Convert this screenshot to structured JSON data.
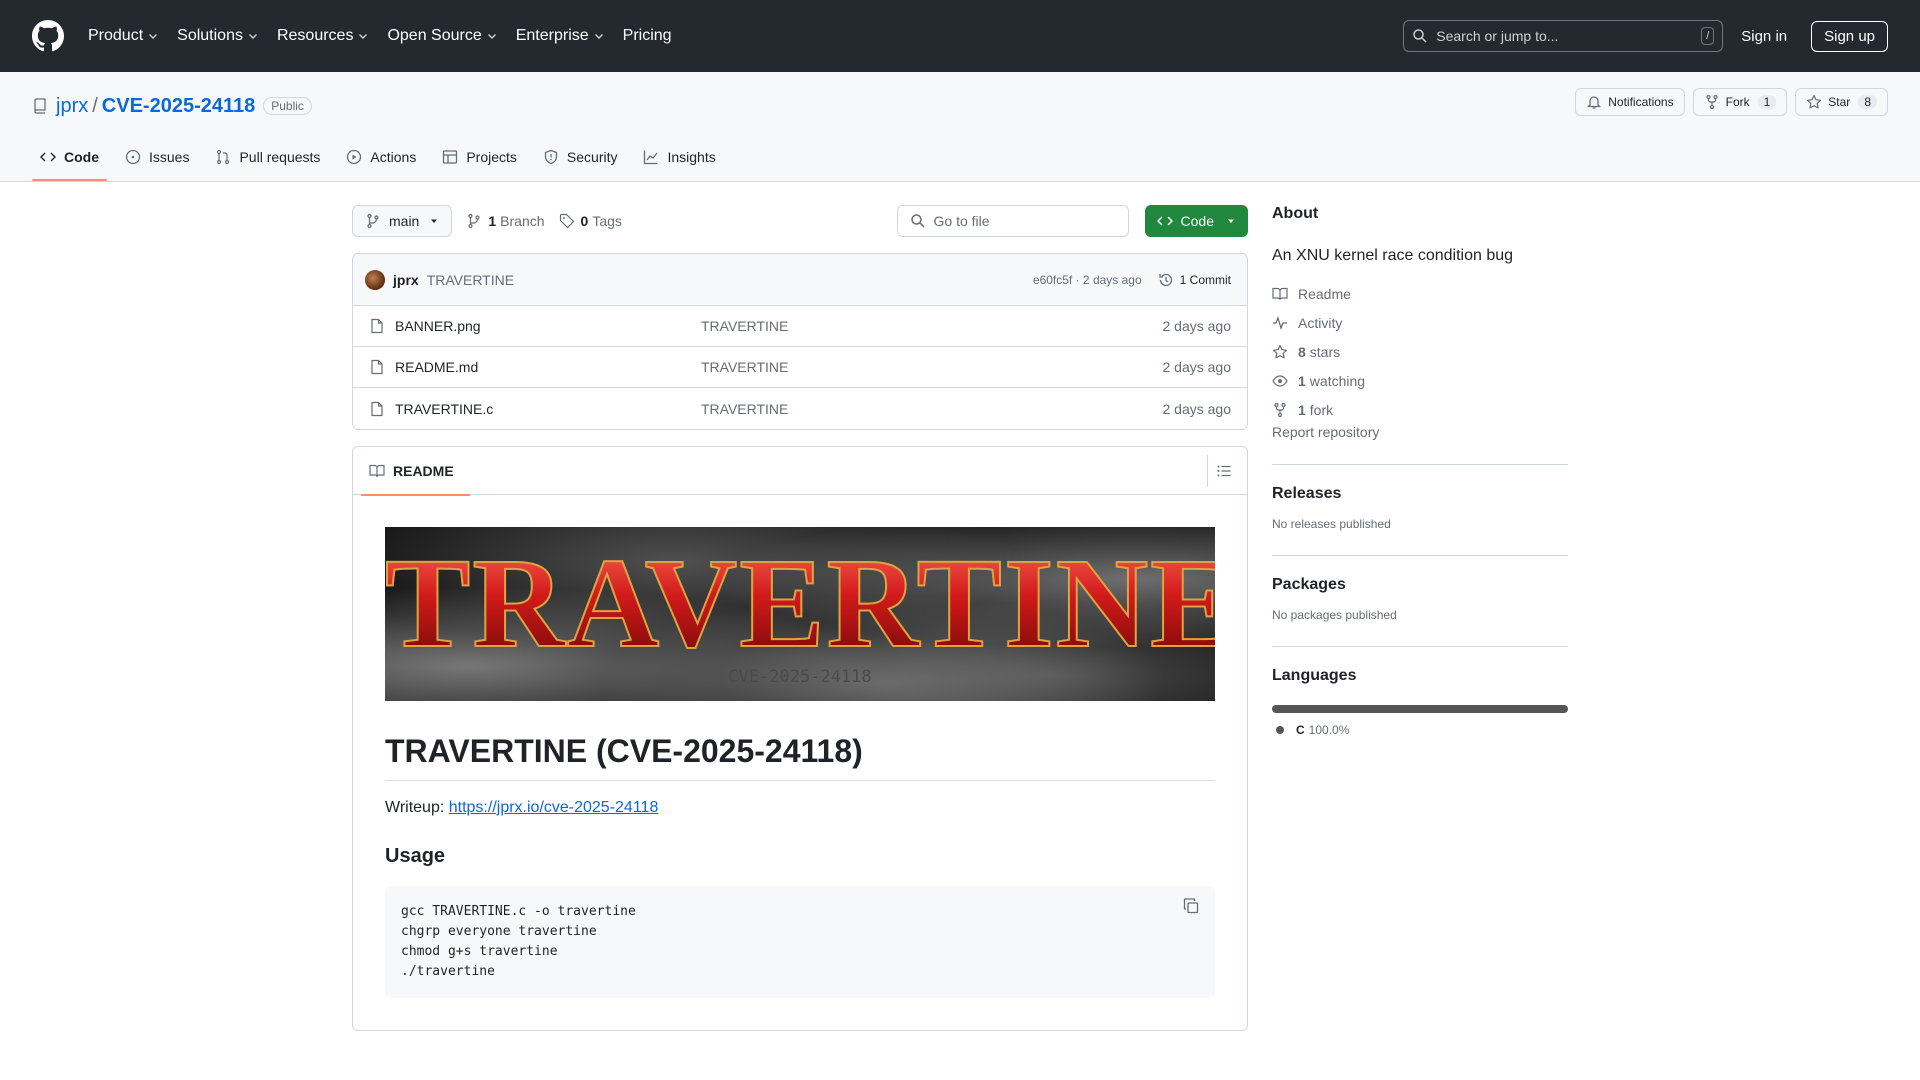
{
  "nav": {
    "items": [
      "Product",
      "Solutions",
      "Resources",
      "Open Source",
      "Enterprise",
      "Pricing"
    ],
    "search_placeholder": "Search or jump to...",
    "search_shortcut": "/",
    "signin": "Sign in",
    "signup": "Sign up"
  },
  "repo": {
    "owner": "jprx",
    "separator": "/",
    "name": "CVE-2025-24118",
    "visibility": "Public",
    "notifications_label": "Notifications",
    "fork_label": "Fork",
    "fork_count": "1",
    "star_label": "Star",
    "star_count": "8"
  },
  "tabs": [
    {
      "label": "Code",
      "icon": "code-icon",
      "active": true
    },
    {
      "label": "Issues",
      "icon": "issue-icon"
    },
    {
      "label": "Pull requests",
      "icon": "pull-request-icon"
    },
    {
      "label": "Actions",
      "icon": "play-icon"
    },
    {
      "label": "Projects",
      "icon": "table-icon"
    },
    {
      "label": "Security",
      "icon": "shield-icon"
    },
    {
      "label": "Insights",
      "icon": "graph-icon"
    }
  ],
  "toolbar": {
    "branch": "main",
    "branch_count": "1",
    "branch_label": "Branch",
    "tag_count": "0",
    "tag_label": "Tags",
    "goto_placeholder": "Go to file",
    "code_button": "Code"
  },
  "commit": {
    "author": "jprx",
    "message": "TRAVERTINE",
    "meta": "e60fc5f · 2 days ago",
    "count_label": "1 Commit"
  },
  "files": [
    {
      "name": "BANNER.png",
      "message": "TRAVERTINE",
      "date": "2 days ago"
    },
    {
      "name": "README.md",
      "message": "TRAVERTINE",
      "date": "2 days ago"
    },
    {
      "name": "TRAVERTINE.c",
      "message": "TRAVERTINE",
      "date": "2 days ago"
    }
  ],
  "readme": {
    "tab_label": "README",
    "banner_title": "TRAVERTINE",
    "banner_subtitle": "CVE-2025-24118",
    "heading": "TRAVERTINE (CVE-2025-24118)",
    "writeup_label": "Writeup: ",
    "writeup_link": "https://jprx.io/cve-2025-24118",
    "usage_heading": "Usage",
    "code_lines": [
      "gcc TRAVERTINE.c -o travertine",
      "chgrp everyone travertine",
      "chmod g+s travertine",
      "./travertine"
    ]
  },
  "about": {
    "title": "About",
    "description": "An XNU kernel race condition bug",
    "readme": "Readme",
    "activity": "Activity",
    "stars_count": "8",
    "stars_label": "stars",
    "watching_count": "1",
    "watching_label": "watching",
    "fork_count": "1",
    "fork_label": "fork",
    "report": "Report repository"
  },
  "releases": {
    "title": "Releases",
    "empty": "No releases published"
  },
  "packages": {
    "title": "Packages",
    "empty": "No packages published"
  },
  "languages": {
    "title": "Languages",
    "items": [
      {
        "name": "C",
        "percent": "100.0%",
        "color": "#555555"
      }
    ]
  },
  "colors": {
    "header_bg": "#24292f",
    "link": "#0969da",
    "primary_button": "#1f883d",
    "active_tab_underline": "#fd8c73"
  }
}
